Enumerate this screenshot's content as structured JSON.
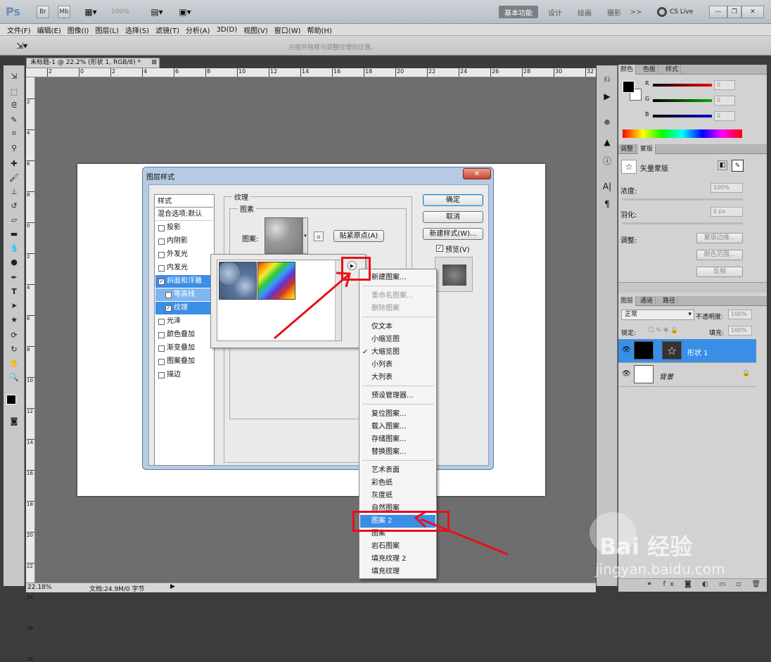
{
  "titlebar": {
    "app_logo": "Ps",
    "zoom_value": "100%",
    "workspaces": [
      "基本功能",
      "设计",
      "绘画",
      "摄影"
    ],
    "more": ">>",
    "cslive": "CS Live"
  },
  "menu": [
    "文件(F)",
    "编辑(E)",
    "图像(I)",
    "图层(L)",
    "选择(S)",
    "滤镜(T)",
    "分析(A)",
    "3D(D)",
    "视图(V)",
    "窗口(W)",
    "帮助(H)"
  ],
  "options_hint": "点按并拖移可调整纹理的位置。",
  "document": {
    "tab_title": "未标题-1 @ 22.2% (形状 1, RGB/8) *",
    "ruler_ticks": [
      "2",
      "0",
      "2",
      "4",
      "6",
      "8",
      "10",
      "12",
      "14",
      "16",
      "18",
      "20",
      "22",
      "24",
      "26",
      "28",
      "30",
      "32"
    ],
    "vruler_ticks": [
      "2",
      "4",
      "6",
      "8",
      "0",
      "2",
      "4",
      "6",
      "8",
      "10",
      "12",
      "14",
      "16",
      "18",
      "20",
      "22",
      "24",
      "26",
      "28"
    ],
    "status_zoom": "22.18%",
    "status_doc": "文档:24.9M/0 字节"
  },
  "dialog": {
    "title": "图层样式",
    "styles_header": "样式",
    "blend_options": "混合选项:默认",
    "items": [
      {
        "label": "投影",
        "checked": false
      },
      {
        "label": "内阴影",
        "checked": false
      },
      {
        "label": "外发光",
        "checked": false
      },
      {
        "label": "内发光",
        "checked": false
      },
      {
        "label": "斜面和浮雕",
        "checked": true
      },
      {
        "label": "等高线",
        "checked": false
      },
      {
        "label": "纹理",
        "checked": true
      },
      {
        "label": "光泽",
        "checked": false
      },
      {
        "label": "颜色叠加",
        "checked": false
      },
      {
        "label": "渐变叠加",
        "checked": false
      },
      {
        "label": "图案叠加",
        "checked": false
      },
      {
        "label": "描边",
        "checked": false
      }
    ],
    "texture_group": "纹理",
    "pattern_group": "图素",
    "pattern_label": "图案:",
    "snap_button": "贴紧原点(A)",
    "ok_button": "确定",
    "cancel_button": "取消",
    "new_style_button": "新建样式(W)...",
    "preview_label": "预览(V)"
  },
  "context_menu": {
    "groups": [
      [
        "新建图案..."
      ],
      [
        "重命名图案...",
        "删除图案"
      ],
      [
        "仅文本",
        "小缩览图",
        "大缩览图",
        "小列表",
        "大列表"
      ],
      [
        "预设管理器..."
      ],
      [
        "复位图案...",
        "载入图案...",
        "存储图案...",
        "替换图案..."
      ],
      [
        "艺术表面",
        "彩色纸",
        "灰度纸",
        "自然图案",
        "图案 2",
        "图案",
        "岩石图案",
        "填充纹理 2",
        "填充纹理"
      ]
    ],
    "disabled": [
      "重命名图案...",
      "删除图案"
    ],
    "checked": "大缩览图",
    "highlighted": "图案 2"
  },
  "panels": {
    "color_tabs": [
      "颜色",
      "色板",
      "样式"
    ],
    "channels": [
      {
        "name": "R",
        "value": "0"
      },
      {
        "name": "G",
        "value": "0"
      },
      {
        "name": "B",
        "value": "0"
      }
    ],
    "adjust_tabs": [
      "调整",
      "蒙版"
    ],
    "mask_title": "矢量蒙版",
    "density_label": "浓度:",
    "density_value": "100%",
    "feather_label": "羽化:",
    "feather_value": "0 px",
    "refine_label": "调整:",
    "mask_edge_button": "蒙版边缘...",
    "color_range_button": "颜色范围...",
    "invert_button": "反相",
    "layers_tabs": [
      "图层",
      "通道",
      "路径"
    ],
    "blend_mode": "正常",
    "opacity_label": "不透明度:",
    "opacity_value": "100%",
    "lock_label": "锁定:",
    "fill_label": "填充:",
    "fill_value": "100%",
    "layers": [
      {
        "name": "形状 1",
        "selected": true,
        "locked": false
      },
      {
        "name": "背景",
        "selected": false,
        "locked": true
      }
    ]
  },
  "watermark": {
    "brand": "Bai 经验",
    "url": "jingyan.baidu.com"
  },
  "colors": {
    "accent": "#3a8ee6",
    "annotation_red": "#e8101a"
  }
}
